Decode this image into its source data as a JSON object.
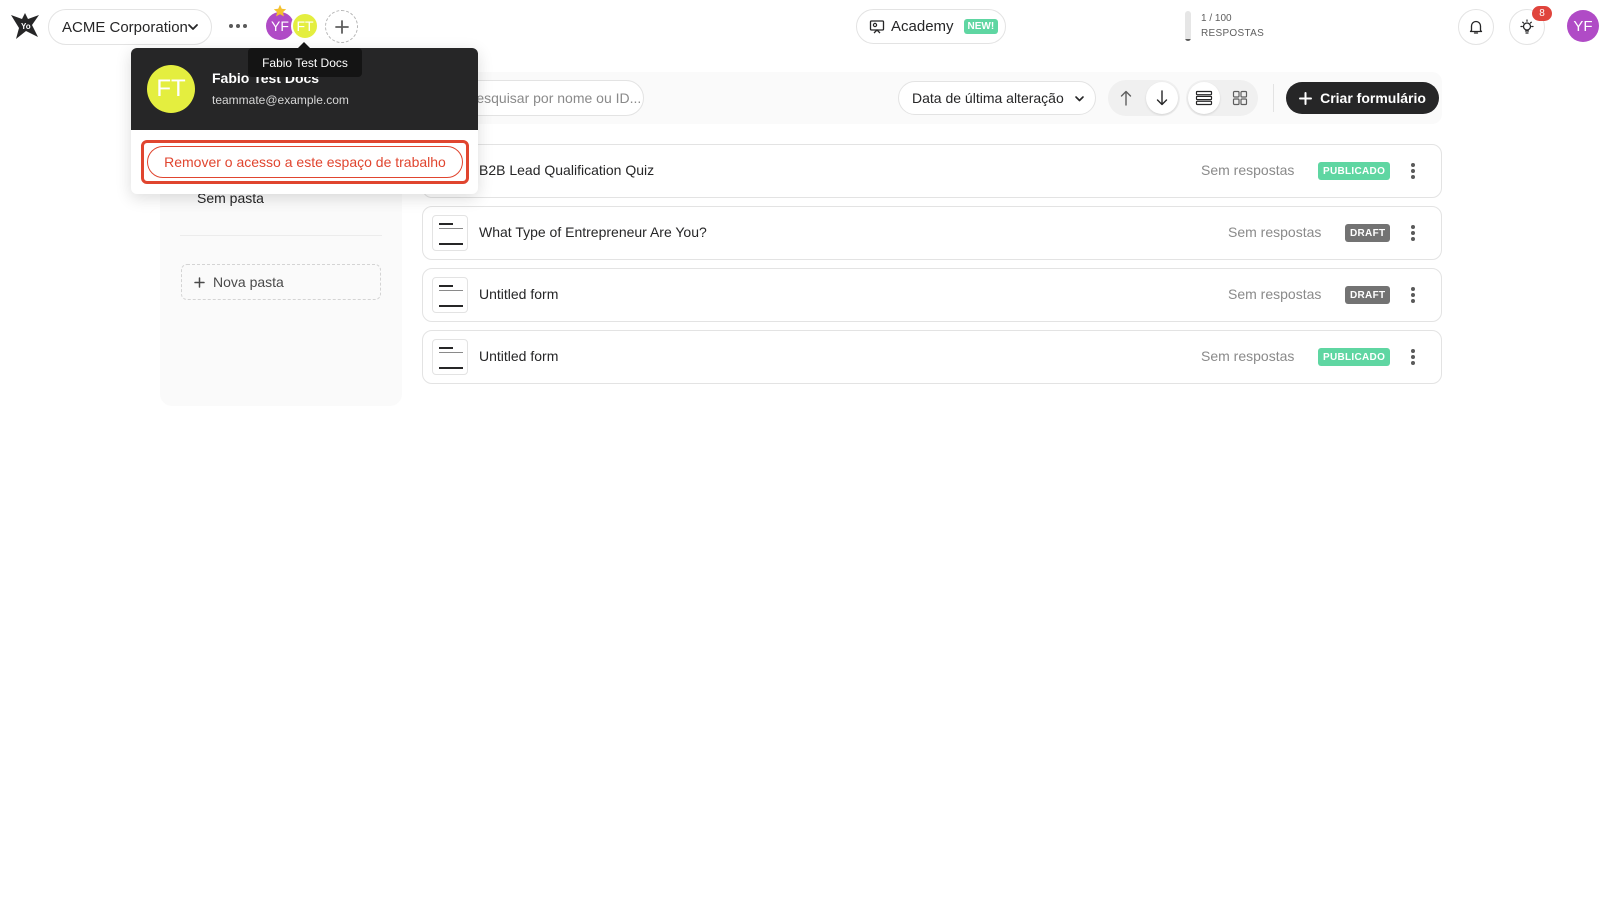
{
  "workspace": {
    "name": "ACME Corporation"
  },
  "members": [
    {
      "initials": "YF",
      "color": "#b04bc6",
      "owner": true
    },
    {
      "initials": "FT",
      "color": "#e4ee3f"
    }
  ],
  "tooltip": {
    "text": "Fabio Test Docs"
  },
  "member_popover": {
    "avatar_initials": "FT",
    "name": "Fabio Test Docs",
    "email": "teammate@example.com",
    "remove_label": "Remover o acesso a este espaço de trabalho"
  },
  "academy": {
    "label": "Academy",
    "badge": "NEW!"
  },
  "quota": {
    "count": "1 / 100",
    "label": "RESPOSTAS",
    "used": 1,
    "total": 100
  },
  "notifications": {
    "badge": "8"
  },
  "user": {
    "initials": "YF",
    "color": "#b04bc6"
  },
  "sidebar": {
    "no_folder_label": "Sem pasta",
    "new_folder_label": "Nova pasta"
  },
  "toolbar": {
    "search_placeholder": "Pesquisar por nome ou ID...",
    "sort_label": "Data de última alteração",
    "create_label": "Criar formulário"
  },
  "colors": {
    "published": "#5fd6a2",
    "draft": "#737373",
    "danger": "#e0452f",
    "dark": "#262627"
  },
  "forms": [
    {
      "title": "B2B Lead Qualification Quiz",
      "responses": "Sem respostas",
      "status": "PUBLICADO"
    },
    {
      "title": "What Type of Entrepreneur Are You?",
      "responses": "Sem respostas",
      "status": "DRAFT"
    },
    {
      "title": "Untitled form",
      "responses": "Sem respostas",
      "status": "DRAFT"
    },
    {
      "title": "Untitled form",
      "responses": "Sem respostas",
      "status": "PUBLICADO"
    }
  ]
}
